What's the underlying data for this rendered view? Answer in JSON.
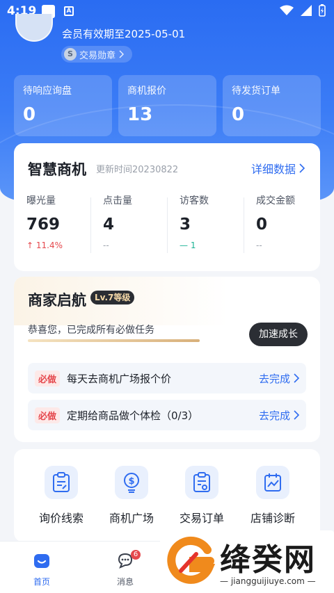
{
  "status_bar": {
    "time": "4:19",
    "store_icon_letter": "A"
  },
  "profile": {
    "membership": "会员有效期至2025-05-01",
    "medal_letter": "S",
    "medal_label": "交易勋章"
  },
  "stats": [
    {
      "label": "待响应询盘",
      "value": "0"
    },
    {
      "label": "商机报价",
      "value": "13"
    },
    {
      "label": "待发货订单",
      "value": "0"
    }
  ],
  "smart": {
    "title": "智慧商机",
    "update_time": "更新时间20230822",
    "detail_link": "详细数据",
    "metrics": [
      {
        "label": "曝光量",
        "value": "769",
        "change": "11.4%"
      },
      {
        "label": "点击量",
        "value": "4",
        "change": "--"
      },
      {
        "label": "访客数",
        "value": "3",
        "change": "1"
      },
      {
        "label": "成交金额",
        "value": "0",
        "change": "--"
      }
    ]
  },
  "launch": {
    "title": "商家启航",
    "level": "Lv.7等级",
    "congrats": "恭喜您，已完成所有必做任务",
    "progress": 1.0,
    "grow_button": "加速成长",
    "tasks": [
      {
        "tag": "必做",
        "text": "每天去商机广场报个价",
        "action": "去完成"
      },
      {
        "tag": "必做",
        "text": "定期给商品做个体检（0/3）",
        "action": "去完成"
      }
    ]
  },
  "tools": [
    {
      "label": "询价线索",
      "icon": "clipboard-edit-icon"
    },
    {
      "label": "商机广场",
      "icon": "dollar-bulb-icon"
    },
    {
      "label": "交易订单",
      "icon": "clipboard-gear-icon"
    },
    {
      "label": "店铺诊断",
      "icon": "calendar-chart-icon"
    }
  ],
  "tabbar": {
    "home": "首页",
    "messages": "消息",
    "message_badge": "6"
  },
  "watermark": {
    "name": "绛癸网",
    "url": "jiangguijiuye.com"
  },
  "colors": {
    "primary": "#2f6cf0",
    "hero": "#3b7cf6",
    "danger": "#e5484d",
    "success": "#1bb394"
  }
}
